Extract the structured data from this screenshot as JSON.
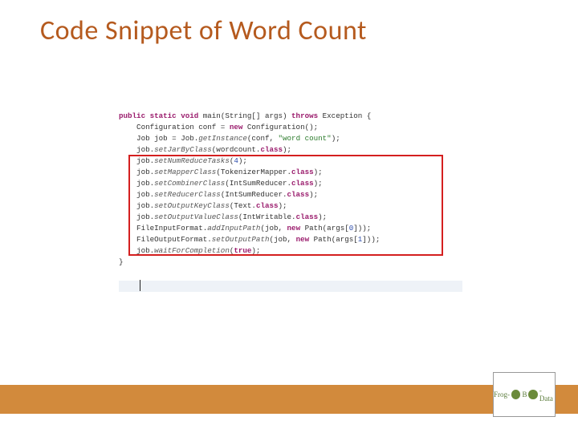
{
  "title": "Code Snippet of Word Count",
  "code": {
    "l01_a": "public static void",
    "l01_b": " main(String[] args) ",
    "l01_c": "throws",
    "l01_d": " Exception {",
    "l02_a": "    Configuration conf = ",
    "l02_b": "new",
    "l02_c": " Configuration();",
    "l03_a": "    Job job = Job.",
    "l03_b": "getInstance",
    "l03_c": "(conf, ",
    "l03_d": "\"word count\"",
    "l03_e": ");",
    "l04_a": "    job.",
    "l04_b": "setJarByClass",
    "l04_c": "(wordcount.",
    "l04_d": "class",
    "l04_e": ");",
    "l05_a": "    job.",
    "l05_b": "setNumReduceTasks",
    "l05_c": "(",
    "l05_d": "4",
    "l05_e": ");",
    "l06_a": "    job.",
    "l06_b": "setMapperClass",
    "l06_c": "(TokenizerMapper.",
    "l06_d": "class",
    "l06_e": ");",
    "l07_a": "    job.",
    "l07_b": "setCombinerClass",
    "l07_c": "(IntSumReducer.",
    "l07_d": "class",
    "l07_e": ");",
    "l08_a": "    job.",
    "l08_b": "setReducerClass",
    "l08_c": "(IntSumReducer.",
    "l08_d": "class",
    "l08_e": ");",
    "l09_a": "    job.",
    "l09_b": "setOutputKeyClass",
    "l09_c": "(Text.",
    "l09_d": "class",
    "l09_e": ");",
    "l10_a": "    job.",
    "l10_b": "setOutputValueClass",
    "l10_c": "(IntWritable.",
    "l10_d": "class",
    "l10_e": ");",
    "l11_a": "    FileInputFormat.",
    "l11_b": "addInputPath",
    "l11_c": "(job, ",
    "l11_d": "new",
    "l11_e": " Path(args[",
    "l11_f": "0",
    "l11_g": "]));",
    "l12_a": "    FileOutputFormat.",
    "l12_b": "setOutputPath",
    "l12_c": "(job, ",
    "l12_d": "new",
    "l12_e": " Path(args[",
    "l12_f": "1",
    "l12_g": "]));",
    "gap": "",
    "l13_a": "    job.",
    "l13_b": "waitForCompletion",
    "l13_c": "(",
    "l13_d": "true",
    "l13_e": ");",
    "l14": "",
    "l15": "}"
  },
  "logo": {
    "text_left": "Frog-",
    "text_right": "-Data",
    "glyph": "B"
  }
}
